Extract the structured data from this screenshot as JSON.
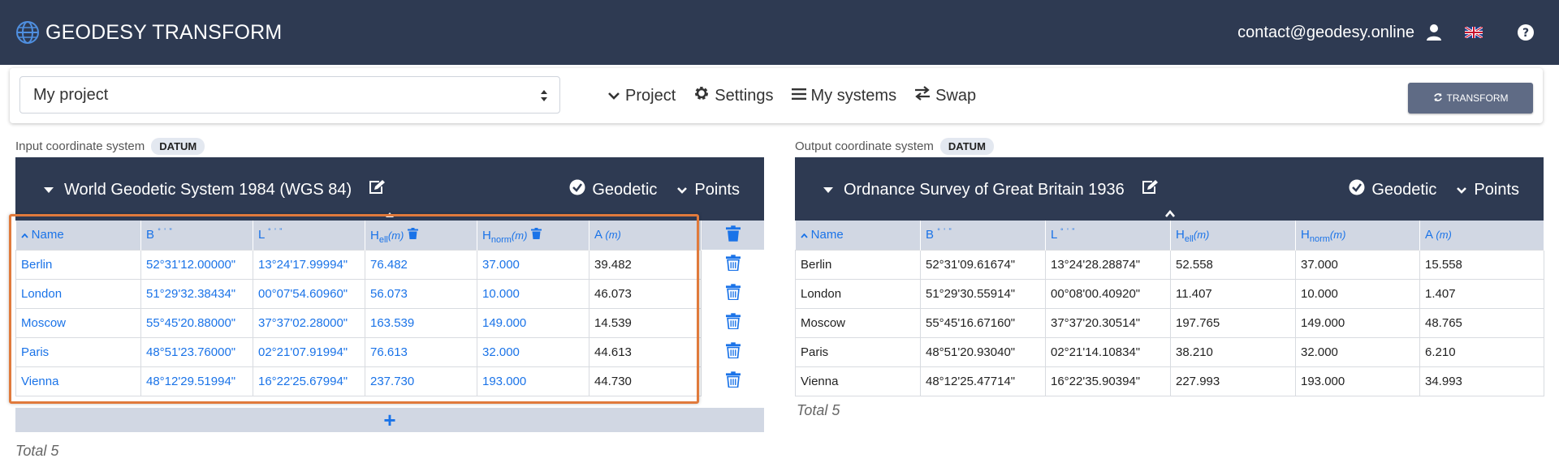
{
  "header": {
    "brand": "GEODESY TRANSFORM",
    "email": "contact@geodesy.online"
  },
  "toolbar": {
    "project_value": "My project",
    "menu": [
      {
        "label": "Project"
      },
      {
        "label": "Settings"
      },
      {
        "label": "My systems"
      },
      {
        "label": "Swap"
      }
    ],
    "transform_label": "TRANSFORM"
  },
  "input": {
    "caption": "Input coordinate system",
    "badge": "DATUM",
    "title": "World Geodetic System 1984 (WGS 84)",
    "geodetic": "Geodetic",
    "points": "Points",
    "columns": {
      "name": "Name",
      "b": "B",
      "l": "L",
      "dots": "° ' \"",
      "h": "H",
      "ell": "ell",
      "norm": "norm",
      "m": "(m)",
      "a": "A"
    },
    "rows": [
      {
        "name": "Berlin",
        "b": "52°31'12.00000\"",
        "l": "13°24'17.99994\"",
        "hell": "76.482",
        "hnorm": "37.000",
        "a": "39.482"
      },
      {
        "name": "London",
        "b": "51°29'32.38434\"",
        "l": "00°07'54.60960\"",
        "hell": "56.073",
        "hnorm": "10.000",
        "a": "46.073"
      },
      {
        "name": "Moscow",
        "b": "55°45'20.88000\"",
        "l": "37°37'02.28000\"",
        "hell": "163.539",
        "hnorm": "149.000",
        "a": "14.539"
      },
      {
        "name": "Paris",
        "b": "48°51'23.76000\"",
        "l": "02°21'07.91994\"",
        "hell": "76.613",
        "hnorm": "32.000",
        "a": "44.613"
      },
      {
        "name": "Vienna",
        "b": "48°12'29.51994\"",
        "l": "16°22'25.67994\"",
        "hell": "237.730",
        "hnorm": "193.000",
        "a": "44.730"
      }
    ],
    "add_symbol": "+",
    "total": "Total 5"
  },
  "output": {
    "caption": "Output coordinate system",
    "badge": "DATUM",
    "title": "Ordnance Survey of Great Britain 1936",
    "geodetic": "Geodetic",
    "points": "Points",
    "rows": [
      {
        "name": "Berlin",
        "b": "52°31'09.61674\"",
        "l": "13°24'28.28874\"",
        "hell": "52.558",
        "hnorm": "37.000",
        "a": "15.558"
      },
      {
        "name": "London",
        "b": "51°29'30.55914\"",
        "l": "00°08'00.40920\"",
        "hell": "11.407",
        "hnorm": "10.000",
        "a": "1.407"
      },
      {
        "name": "Moscow",
        "b": "55°45'16.67160\"",
        "l": "37°37'20.30514\"",
        "hell": "197.765",
        "hnorm": "149.000",
        "a": "48.765"
      },
      {
        "name": "Paris",
        "b": "48°51'20.93040\"",
        "l": "02°21'14.10834\"",
        "hell": "38.210",
        "hnorm": "32.000",
        "a": "6.210"
      },
      {
        "name": "Vienna",
        "b": "48°12'25.47714\"",
        "l": "16°22'35.90394\"",
        "hell": "227.993",
        "hnorm": "193.000",
        "a": "34.993"
      }
    ],
    "total": "Total 5"
  },
  "colors": {
    "navbar": "#2e3a52",
    "header_row": "#d1d7e3",
    "link_blue": "#1a73e8",
    "highlight": "#e07a3c",
    "transform_button": "#5f6b85"
  }
}
